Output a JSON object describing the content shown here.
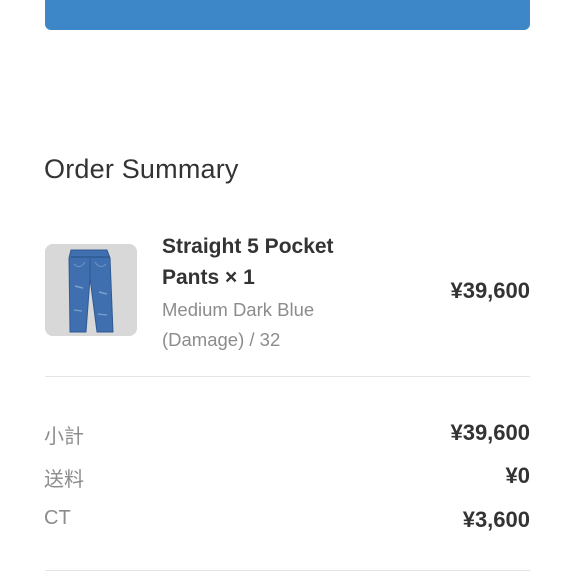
{
  "order_summary": {
    "title": "Order Summary",
    "item": {
      "name_line1": "Straight 5 Pocket",
      "name_line2": "Pants × 1",
      "variant_line1": "Medium Dark Blue",
      "variant_line2": "(Damage) / 32",
      "price": "¥39,600",
      "thumbnail": "jeans-thumbnail-icon"
    },
    "rows": [
      {
        "label": "小計",
        "value": "¥39,600"
      },
      {
        "label": "送料",
        "value": "¥0"
      },
      {
        "label": "CT",
        "value": "¥3,600"
      }
    ]
  },
  "colors": {
    "primary_button": "#3d87c9",
    "thumbnail_bg": "#d8d8d8",
    "denim": "#3f6fae"
  }
}
